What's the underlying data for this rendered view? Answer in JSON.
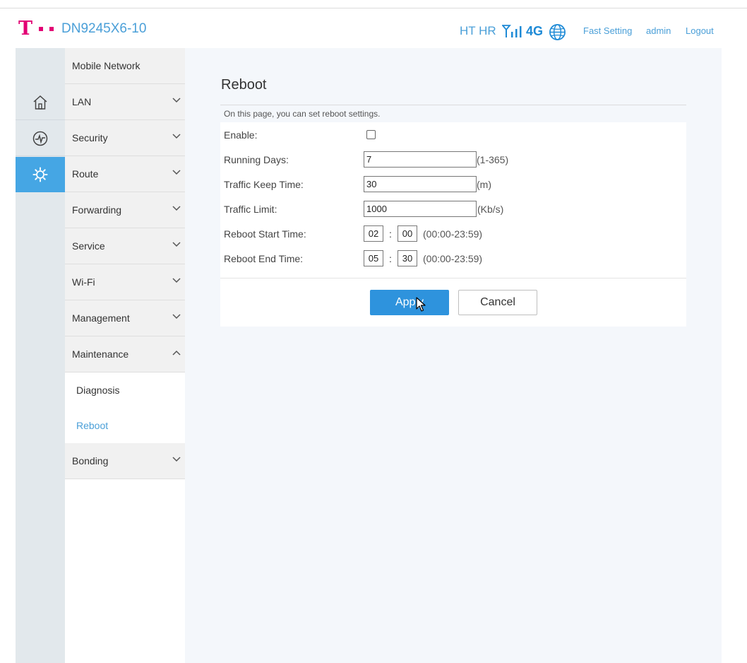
{
  "header": {
    "brand_letter": "T",
    "model": "DN9245X6-10",
    "operator": "HT HR",
    "network_type": "4G",
    "signal_icon": "signal-icon",
    "globe_icon": "globe-icon",
    "links": {
      "fast_setting": "Fast Setting",
      "user": "admin",
      "logout": "Logout"
    }
  },
  "rail": {
    "items": [
      {
        "icon": "home-icon"
      },
      {
        "icon": "status-icon"
      },
      {
        "icon": "gear-icon",
        "active": true
      }
    ]
  },
  "menu": {
    "items": [
      {
        "label": "Mobile Network"
      },
      {
        "label": "LAN"
      },
      {
        "label": "Security"
      },
      {
        "label": "Route"
      },
      {
        "label": "Forwarding"
      },
      {
        "label": "Service"
      },
      {
        "label": "Wi-Fi"
      },
      {
        "label": "Management"
      },
      {
        "label": "Maintenance",
        "expanded": true
      },
      {
        "label": "Bonding"
      }
    ],
    "submenu": [
      {
        "label": "Diagnosis"
      },
      {
        "label": "Reboot",
        "active": true
      }
    ]
  },
  "content": {
    "title": "Reboot",
    "description": "On this page, you can set reboot settings.",
    "form": {
      "enable_label": "Enable:",
      "enable_checked": false,
      "running_days_label": "Running Days:",
      "running_days_value": "7",
      "running_days_hint": "(1-365)",
      "keep_time_label": "Traffic Keep Time:",
      "keep_time_value": "30",
      "keep_time_hint": "(m)",
      "traffic_limit_label": "Traffic Limit:",
      "traffic_limit_value": "1000",
      "traffic_limit_hint": "(Kb/s)",
      "start_label": "Reboot Start Time:",
      "start_hour": "02",
      "start_minute": "00",
      "start_hint": "(00:00-23:59)",
      "end_label": "Reboot End Time:",
      "end_hour": "05",
      "end_minute": "30",
      "end_hint": "(00:00-23:59)",
      "separator": ":"
    },
    "buttons": {
      "apply": "Apply",
      "cancel": "Cancel"
    }
  },
  "colors": {
    "brand_magenta": "#e20074",
    "accent_blue": "#45a6e4",
    "apply_blue": "#2e93dd"
  }
}
